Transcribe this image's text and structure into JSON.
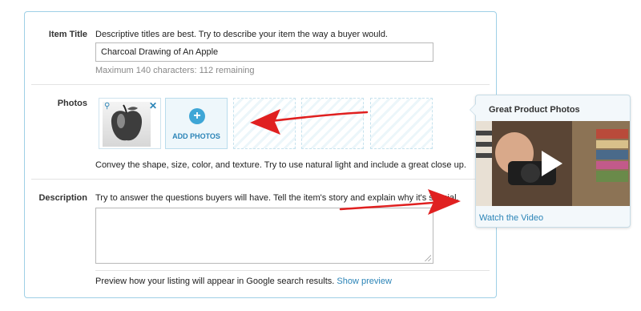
{
  "item_title": {
    "label": "Item Title",
    "hint": "Descriptive titles are best. Try to describe your item the way a buyer would.",
    "value": "Charcoal Drawing of An Apple",
    "counter": "Maximum 140 characters: 112 remaining"
  },
  "photos": {
    "label": "Photos",
    "add_label": "ADD PHOTOS",
    "hint": "Convey the shape, size, color, and texture. Try to use natural light and include a great close up."
  },
  "description": {
    "label": "Description",
    "hint": "Try to answer the questions buyers will have. Tell the item's story and explain why it's special.",
    "value": ""
  },
  "preview": {
    "text": "Preview how your listing will appear in Google search results.",
    "link": "Show preview"
  },
  "popover": {
    "title": "Great Product Photos",
    "link": "Watch the Video"
  },
  "colors": {
    "accent": "#2b84b7",
    "panel_border": "#9fd0e6",
    "annotation_red": "#e02020"
  },
  "icons": {
    "zoom": "magnifier-icon",
    "remove": "close-icon",
    "add": "plus-icon",
    "play": "play-icon"
  }
}
